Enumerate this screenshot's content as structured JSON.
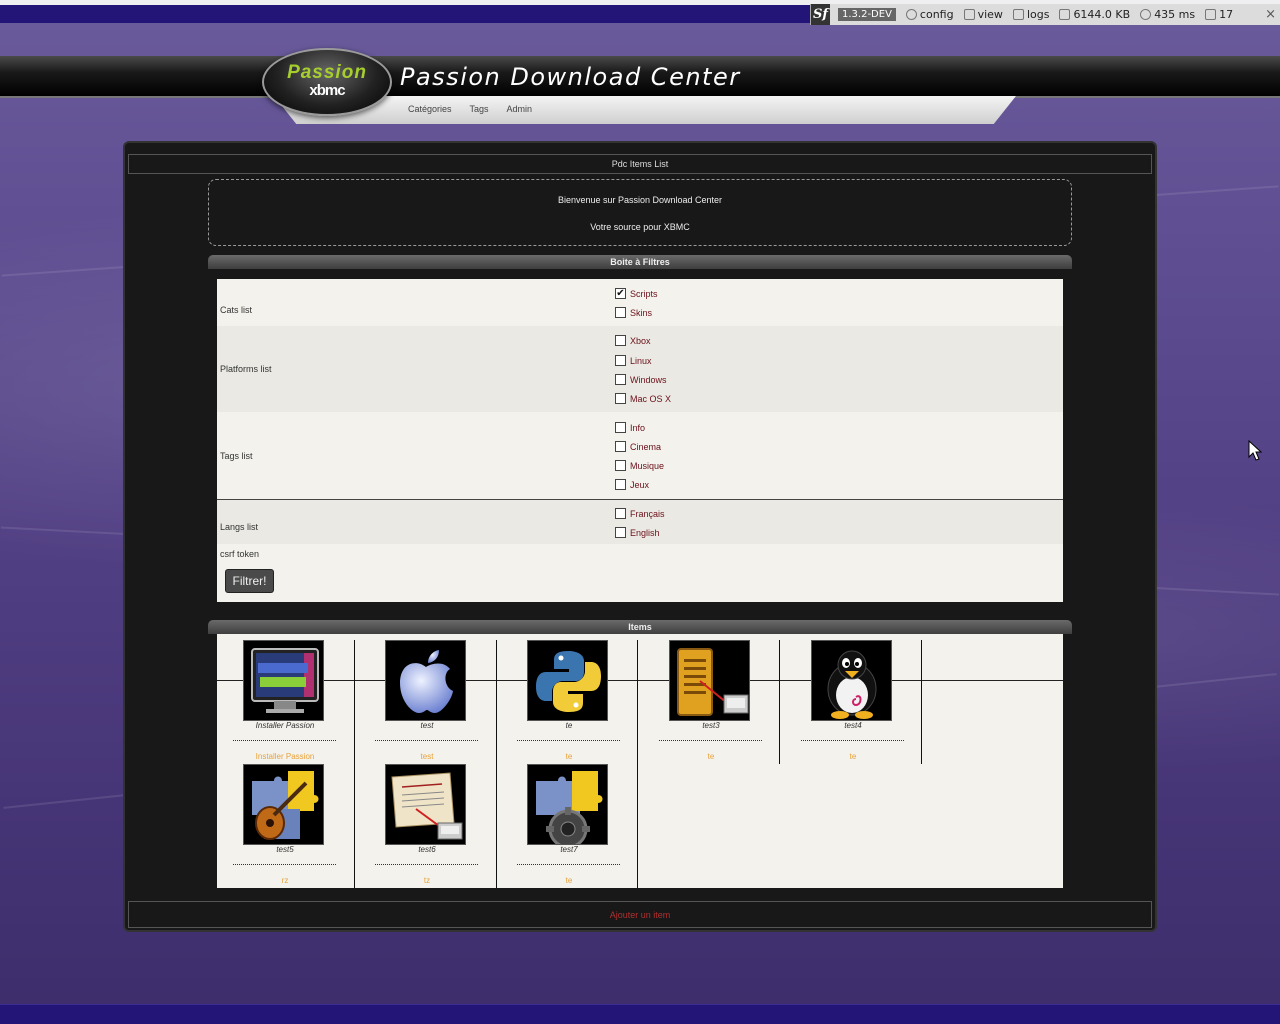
{
  "debug_toolbar": {
    "logo": "Sf",
    "version": "1.3.2-DEV",
    "config": "config",
    "view": "view",
    "logs": "logs",
    "memory": "6144.0 KB",
    "time": "435 ms",
    "queries": "17",
    "close": "×"
  },
  "header": {
    "logo_line1": "Passion",
    "logo_line2": "xbmc",
    "title": "Passion Download Center",
    "nav": [
      "Catégories",
      "Tags",
      "Admin"
    ]
  },
  "page_title": "Pdc Items List",
  "welcome": {
    "line1": "Bienvenue sur Passion Download Center",
    "line2": "Votre source pour XBMC"
  },
  "filters": {
    "heading": "Boite à Filtres",
    "cats": {
      "label": "Cats list",
      "options": [
        {
          "label": "Scripts",
          "checked": true
        },
        {
          "label": "Skins",
          "checked": false
        }
      ]
    },
    "platforms": {
      "label": "Platforms list",
      "options": [
        {
          "label": "Xbox",
          "checked": false
        },
        {
          "label": "Linux",
          "checked": false
        },
        {
          "label": "Windows",
          "checked": false
        },
        {
          "label": "Mac OS X",
          "checked": false
        }
      ]
    },
    "tags": {
      "label": "Tags list",
      "options": [
        {
          "label": "Info",
          "checked": false
        },
        {
          "label": "Cinema",
          "checked": false
        },
        {
          "label": "Musique",
          "checked": false
        },
        {
          "label": "Jeux",
          "checked": false
        }
      ]
    },
    "langs": {
      "label": "Langs list",
      "options": [
        {
          "label": "Français",
          "checked": false
        },
        {
          "label": "English",
          "checked": false
        }
      ]
    },
    "csrf_label": "csrf token",
    "submit": "Filtrer!",
    "check_mark": "✔"
  },
  "items": {
    "heading": "Items",
    "list": [
      {
        "name": "Installer Passion",
        "link": "Installer Passion",
        "icon": "installer-passion-icon"
      },
      {
        "name": "test",
        "link": "test",
        "icon": "apple-icon"
      },
      {
        "name": "te",
        "link": "te",
        "icon": "python-icon"
      },
      {
        "name": "test3",
        "link": "te",
        "icon": "ticket-icon"
      },
      {
        "name": "test4",
        "link": "te",
        "icon": "tux-icon"
      },
      {
        "name": "test5",
        "link": "rz",
        "icon": "guitar-puzzle-icon"
      },
      {
        "name": "test6",
        "link": "tz",
        "icon": "scroll-icon"
      },
      {
        "name": "test7",
        "link": "te",
        "icon": "gear-puzzle-icon"
      }
    ]
  },
  "footer": {
    "add_item": "Ajouter un item"
  },
  "colors": {
    "top_bar": "#231577",
    "option_text": "#6b0f1a",
    "item_link": "#e8a23a",
    "footer_link": "#b03030"
  }
}
